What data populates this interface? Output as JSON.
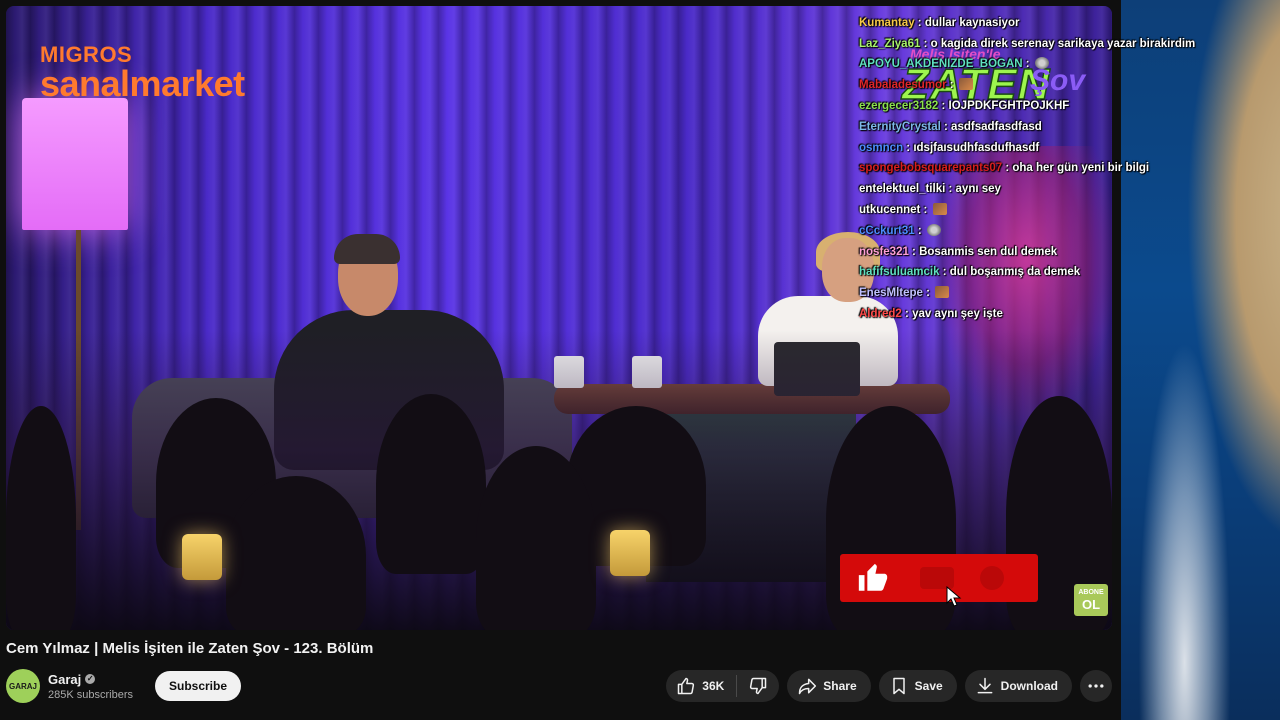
{
  "video": {
    "sponsor_logo": {
      "line1": "MIGROS",
      "line2": "sanalmarket"
    },
    "show_logo": {
      "small": "Melis İşiten'le",
      "big": "ZATEN",
      "sov": "Şov"
    },
    "chat": [
      {
        "user": "Kumantay",
        "color": "#f7c948",
        "msg": "dullar kaynasiyor"
      },
      {
        "user": "Laz_Ziya61",
        "color": "#a7f36b",
        "msg": "o kagida direk serenay sarikaya yazar birakirdim"
      },
      {
        "user": "APOYU_AKDENIZDE_BOGAN",
        "color": "#5fe0c0",
        "msg": "",
        "emote": "ghost"
      },
      {
        "user": "Mabaladesumor",
        "color": "#e0262a",
        "msg": "",
        "emote": "emote"
      },
      {
        "user": "ezergecer3182",
        "color": "#8be04e",
        "msg": "IOJPDKFGHTPOJKHF"
      },
      {
        "user": "EternityCrystal",
        "color": "#7db7e8",
        "msg": "asdfsadfasdfasd"
      },
      {
        "user": "osmncn",
        "color": "#4c8dff",
        "msg": "ıdsjfaısudhfasdufhasdf"
      },
      {
        "user": "spongebobsquarepants07",
        "color": "#d81e1e",
        "msg": "oha her gün yeni bir bilgi"
      },
      {
        "user": "entelektuel_tilki",
        "color": "#ffffff",
        "msg": "aynı sey"
      },
      {
        "user": "utkucennet",
        "color": "#ffffff",
        "msg": "",
        "emote": "emote"
      },
      {
        "user": "cCckurt31",
        "color": "#4c8dff",
        "msg": "",
        "emote": "ghost"
      },
      {
        "user": "nosfe321",
        "color": "#ff9fd6",
        "msg": "Bosanmis sen dul demek"
      },
      {
        "user": "hafifsuluamcik",
        "color": "#5fe0c0",
        "msg": "dul boşanmış da demek"
      },
      {
        "user": "EnesMltepe",
        "color": "#c0c0ff",
        "msg": "",
        "emote": "emote"
      },
      {
        "user": "Aldred2",
        "color": "#ff4a4a",
        "msg": "yav aynı şey işte"
      }
    ],
    "badge": {
      "line1": "ABONE",
      "line2": "OL"
    }
  },
  "meta": {
    "title": "Cem Yılmaz | Melis İşiten ile Zaten Şov - 123. Bölüm",
    "channel": {
      "name": "Garaj",
      "subscribers": "285K subscribers",
      "avatar_text": "GARAJ"
    },
    "subscribe_label": "Subscribe"
  },
  "actions": {
    "likes": "36K",
    "share": "Share",
    "save": "Save",
    "download": "Download"
  },
  "colors": {
    "background": "#0f0f0f",
    "pill": "#272727",
    "like_overlay": "#d40a0a"
  },
  "icons": [
    "thumbs-up-icon",
    "thumbs-down-icon",
    "share-icon",
    "save-icon",
    "download-icon",
    "more-icon",
    "verified-icon"
  ]
}
